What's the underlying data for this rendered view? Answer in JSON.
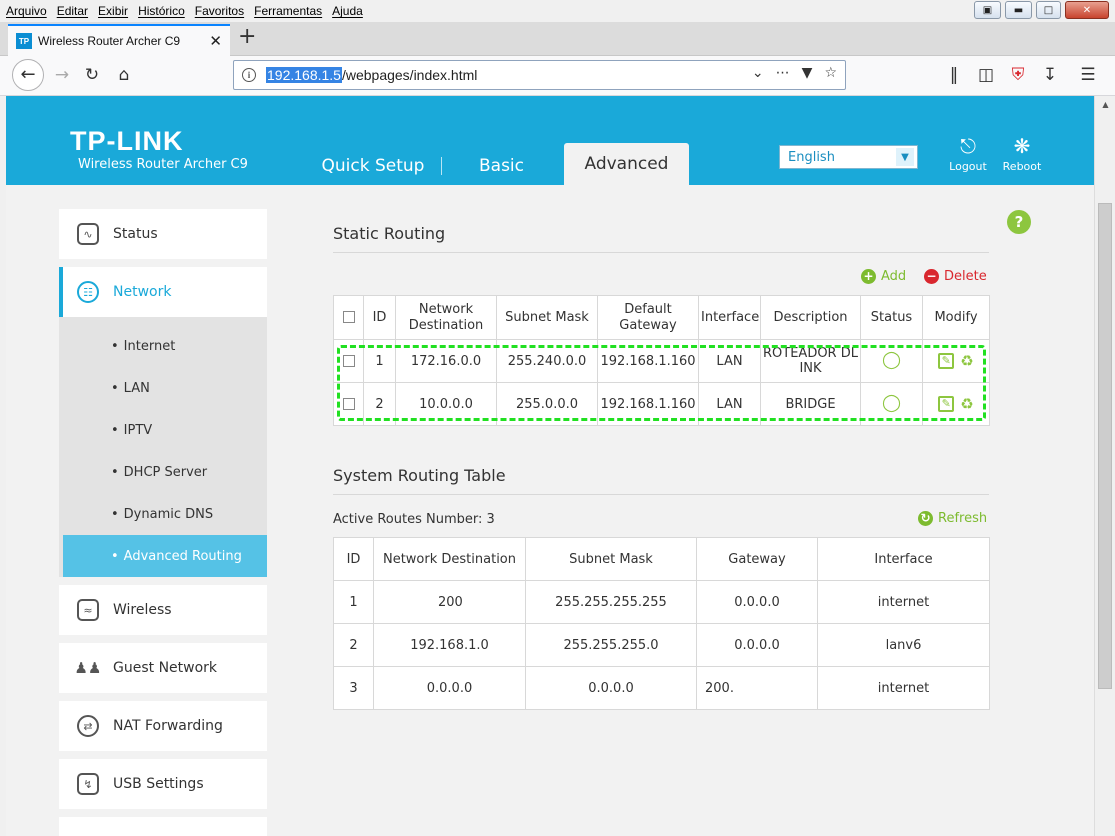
{
  "browser": {
    "menu": [
      "Arquivo",
      "Editar",
      "Exibir",
      "Histórico",
      "Favoritos",
      "Ferramentas",
      "Ajuda"
    ],
    "tab_title": "Wireless Router Archer C9",
    "favicon_text": "TP",
    "url_host": "192.168.1.5",
    "url_path": "/webpages/index.html"
  },
  "header": {
    "brand": "TP-LINK",
    "model": "Wireless Router Archer C9",
    "tabs": [
      "Quick Setup",
      "Basic",
      "Advanced"
    ],
    "language": "English",
    "logout_label": "Logout",
    "reboot_label": "Reboot"
  },
  "sidebar": {
    "items": [
      {
        "label": "Status"
      },
      {
        "label": "Network"
      },
      {
        "label": "Wireless"
      },
      {
        "label": "Guest Network"
      },
      {
        "label": "NAT Forwarding"
      },
      {
        "label": "USB Settings"
      }
    ],
    "network_sub": [
      "Internet",
      "LAN",
      "IPTV",
      "DHCP Server",
      "Dynamic DNS",
      "Advanced Routing"
    ]
  },
  "static_routing": {
    "title": "Static Routing",
    "add_label": "Add",
    "delete_label": "Delete",
    "headers": [
      "ID",
      "Network Destination",
      "Subnet Mask",
      "Default Gateway",
      "Interface",
      "Description",
      "Status",
      "Modify"
    ],
    "rows": [
      {
        "id": "1",
        "dest": "172.16.0.0",
        "mask": "255.240.0.0",
        "gateway": "192.168.1.160",
        "iface": "LAN",
        "desc": "ROTEADOR DLINK"
      },
      {
        "id": "2",
        "dest": "10.0.0.0",
        "mask": "255.0.0.0",
        "gateway": "192.168.1.160",
        "iface": "LAN",
        "desc": "BRIDGE"
      }
    ]
  },
  "system_routing": {
    "title": "System Routing Table",
    "active_routes": "Active Routes Number:",
    "active_count": "3",
    "refresh_label": "Refresh",
    "headers": [
      "ID",
      "Network Destination",
      "Subnet Mask",
      "Gateway",
      "Interface"
    ],
    "rows": [
      {
        "id": "1",
        "dest": "200",
        "mask": "255.255.255.255",
        "gateway": "0.0.0.0",
        "iface": "internet"
      },
      {
        "id": "2",
        "dest": "192.168.1.0",
        "mask": "255.255.255.0",
        "gateway": "0.0.0.0",
        "iface": "lanv6"
      },
      {
        "id": "3",
        "dest": "0.0.0.0",
        "mask": "0.0.0.0",
        "gateway": "200.",
        "iface": "internet"
      }
    ]
  },
  "colors": {
    "brand_blue": "#1aa9d9",
    "accent_green": "#8dc63f",
    "delete_red": "#d9272e",
    "highlight_green": "#21e021"
  }
}
